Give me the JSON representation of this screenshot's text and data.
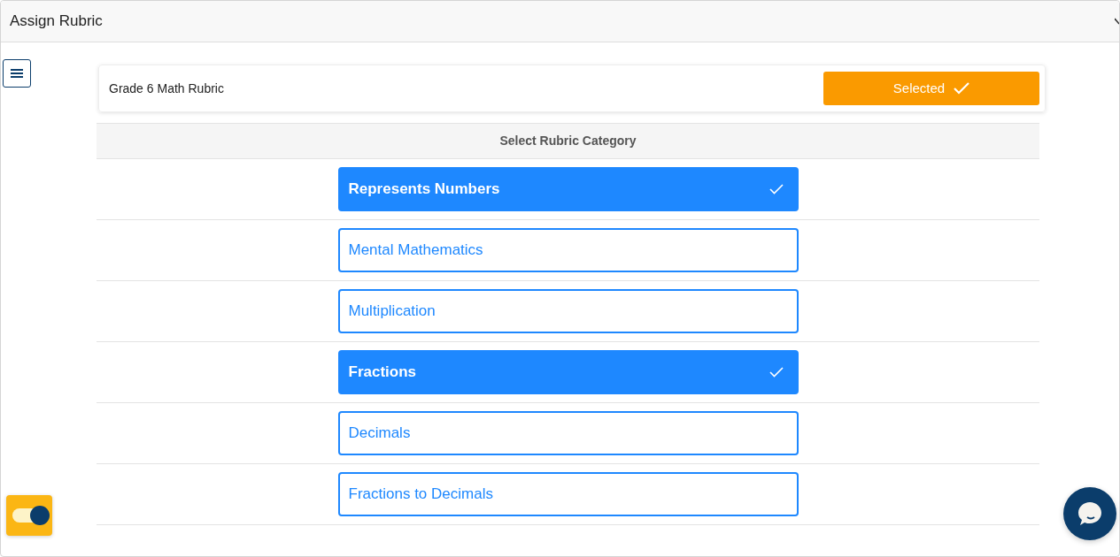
{
  "window": {
    "title": "Assign Rubric"
  },
  "rubric": {
    "name": "Grade 6 Math Rubric",
    "button_label": "Selected",
    "selected": true
  },
  "table": {
    "header": "Select Rubric Category",
    "categories": [
      {
        "label": "Represents Numbers",
        "selected": true
      },
      {
        "label": "Mental Mathematics",
        "selected": false
      },
      {
        "label": "Multiplication",
        "selected": false
      },
      {
        "label": "Fractions",
        "selected": true
      },
      {
        "label": "Decimals",
        "selected": false
      },
      {
        "label": "Fractions to Decimals",
        "selected": false
      }
    ]
  },
  "toggle": {
    "on": true
  }
}
